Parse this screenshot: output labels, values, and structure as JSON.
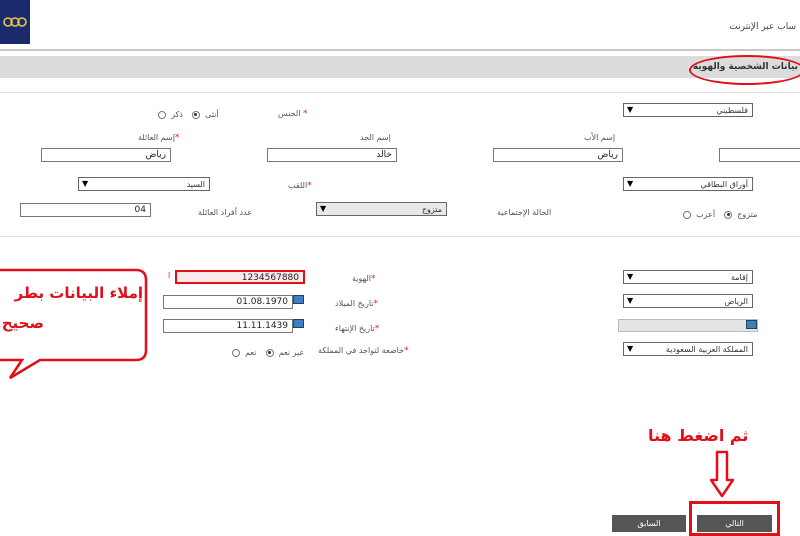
{
  "header": {
    "title": "ساب عبر الإنترنت",
    "logo_icon": "bank-logo-icon"
  },
  "section": {
    "title": "بيانات الشخصية والهوية"
  },
  "personal": {
    "gender_label": "الجنس",
    "gender_male": "ذكر",
    "gender_female": "أنثى",
    "nationality_value": "فلسطيني",
    "first_name_label": "إسم الأب",
    "grandfather_label": "إسم الجد",
    "family_label": "إسم العائلة",
    "father_value": "رياض",
    "grandfather_value": "خالد",
    "family_value": "رياض",
    "education_value": "أوراق البطاقي",
    "title_label": "اللقب",
    "title_value": "السيد",
    "marital_label": "الحالة الإجتماعية",
    "marital_single": "أعزب",
    "marital_married": "متزوج",
    "marital_status_value": "متزوج",
    "family_count_label": "عدد أفراد العائلة",
    "family_count_value": "04"
  },
  "identity": {
    "id_type_value": "إقامة",
    "id_label": "الهوية",
    "id_value": "1234567880",
    "birth_city_value": "الرياض",
    "birth_date_label": "تاريخ الميلاد",
    "birth_date_value": "01.08.1970",
    "expiry_label": "تاريخ الإنتهاء",
    "expiry_value": "11.11.1439",
    "country_value": "المملكة العربية السعودية",
    "residence_label": "خاضعة لتواجد في المملكة",
    "residence_yes": "نعم",
    "residence_no": "غير نعم"
  },
  "annotations": {
    "bubble_line1": "إملاء البيانات بطر",
    "bubble_line2": "صحيح",
    "click_here": "ثم اضغط هنا"
  },
  "footer": {
    "next_label": "التالي",
    "prev_label": "السابق"
  },
  "colors": {
    "accent_red": "#e0101a",
    "logo_blue": "#1a2a6c",
    "section_bar": "#dcdcdc",
    "button_dark": "#555555"
  }
}
